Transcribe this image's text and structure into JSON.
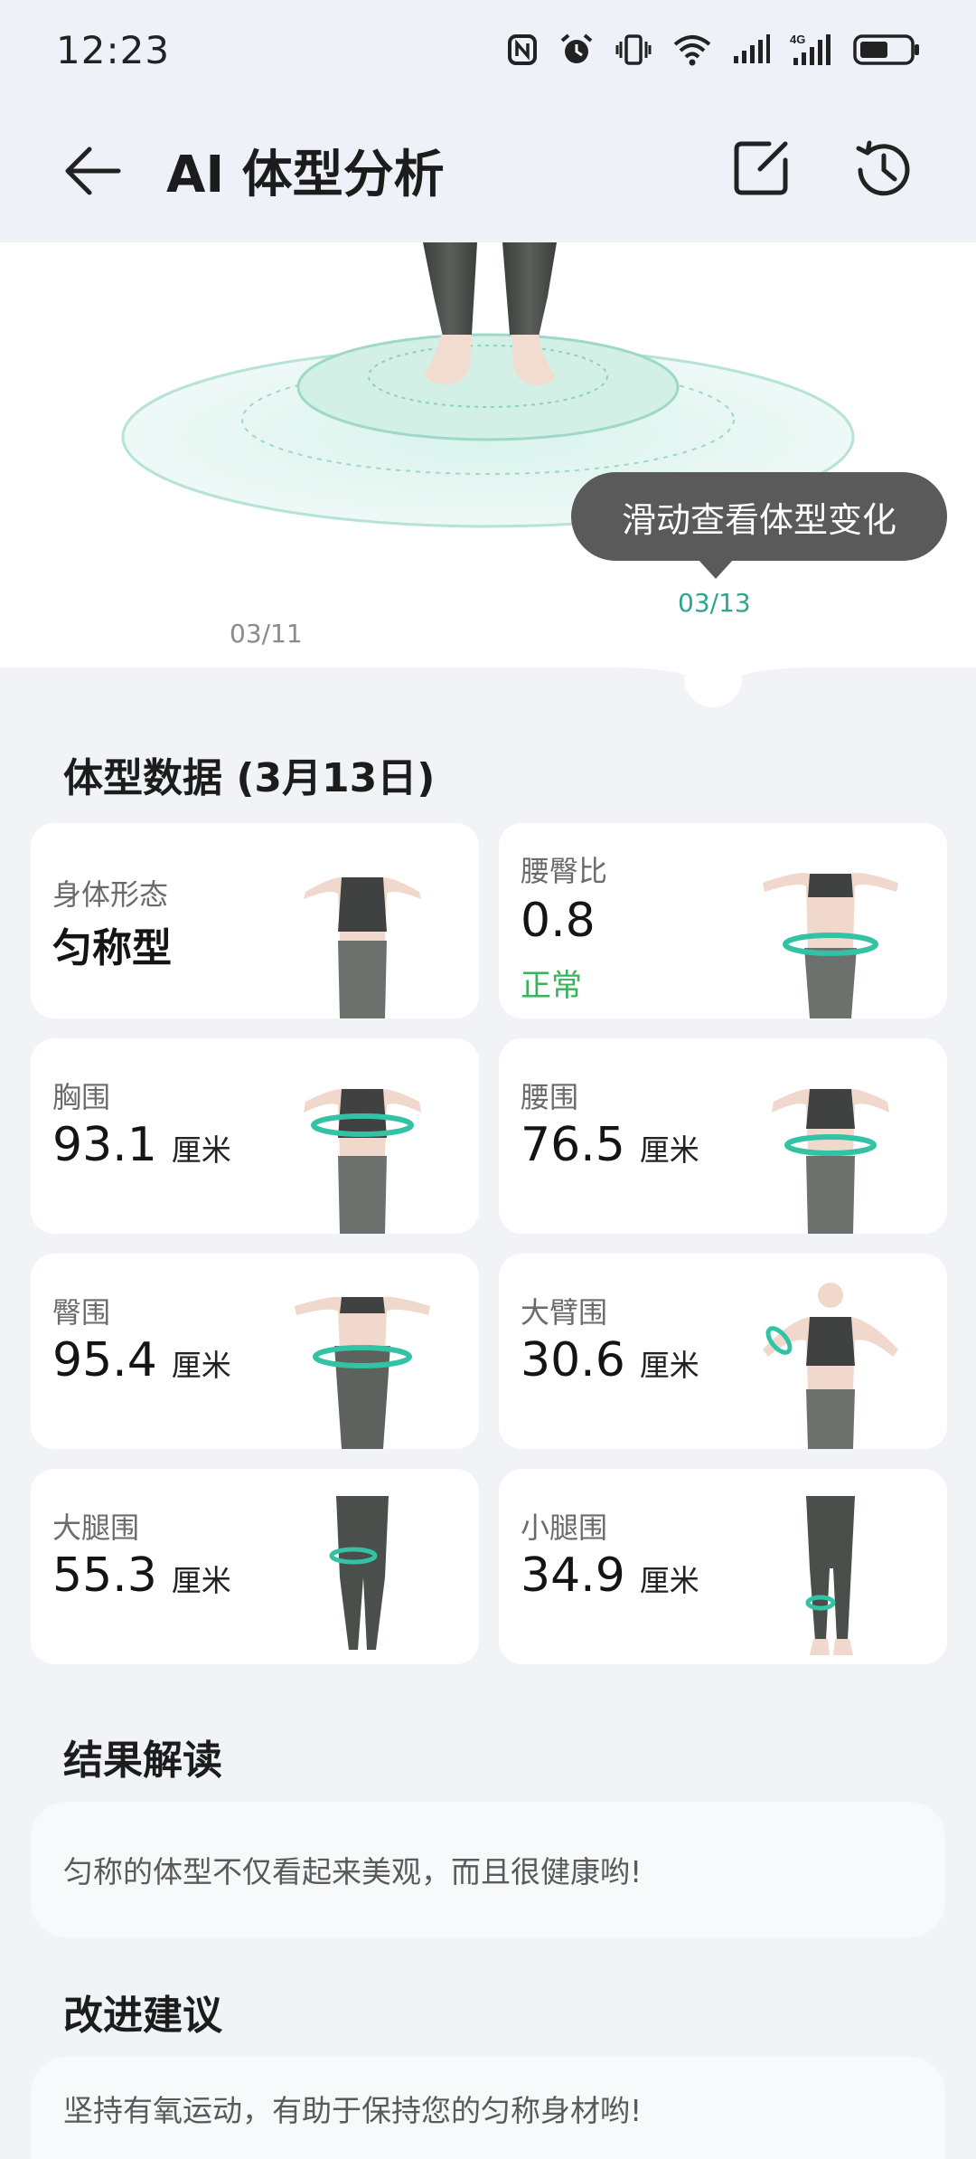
{
  "status_bar": {
    "time": "12:23",
    "icons": [
      "nfc-icon",
      "alarm-icon",
      "vibrate-icon",
      "wifi-icon",
      "signal-icon",
      "signal-4g-icon",
      "battery-icon"
    ]
  },
  "header": {
    "title": "AI 体型分析",
    "icons": [
      "back-arrow-icon",
      "edit-icon",
      "history-icon"
    ]
  },
  "viewer": {
    "tooltip": "滑动查看体型变化",
    "dates": [
      {
        "label": "03/11",
        "active": false
      },
      {
        "label": "03/13",
        "active": true
      }
    ],
    "accent": "#2ea58c"
  },
  "body_data": {
    "title": "体型数据 (3月13日)",
    "cards": [
      {
        "label": "身体形态",
        "value": "匀称型",
        "unit": "",
        "status": ""
      },
      {
        "label": "腰臀比",
        "value": "0.8",
        "unit": "",
        "status": "正常"
      },
      {
        "label": "胸围",
        "value": "93.1",
        "unit": "厘米",
        "status": ""
      },
      {
        "label": "腰围",
        "value": "76.5",
        "unit": "厘米",
        "status": ""
      },
      {
        "label": "臀围",
        "value": "95.4",
        "unit": "厘米",
        "status": ""
      },
      {
        "label": "大臂围",
        "value": "30.6",
        "unit": "厘米",
        "status": ""
      },
      {
        "label": "大腿围",
        "value": "55.3",
        "unit": "厘米",
        "status": ""
      },
      {
        "label": "小腿围",
        "value": "34.9",
        "unit": "厘米",
        "status": ""
      }
    ],
    "status_color": "#39b25a"
  },
  "interpretation": {
    "title": "结果解读",
    "text": "匀称的体型不仅看起来美观，而且很健康哟!"
  },
  "suggestion": {
    "title": "改进建议",
    "text": "坚持有氧运动，有助于保持您的匀称身材哟!"
  }
}
